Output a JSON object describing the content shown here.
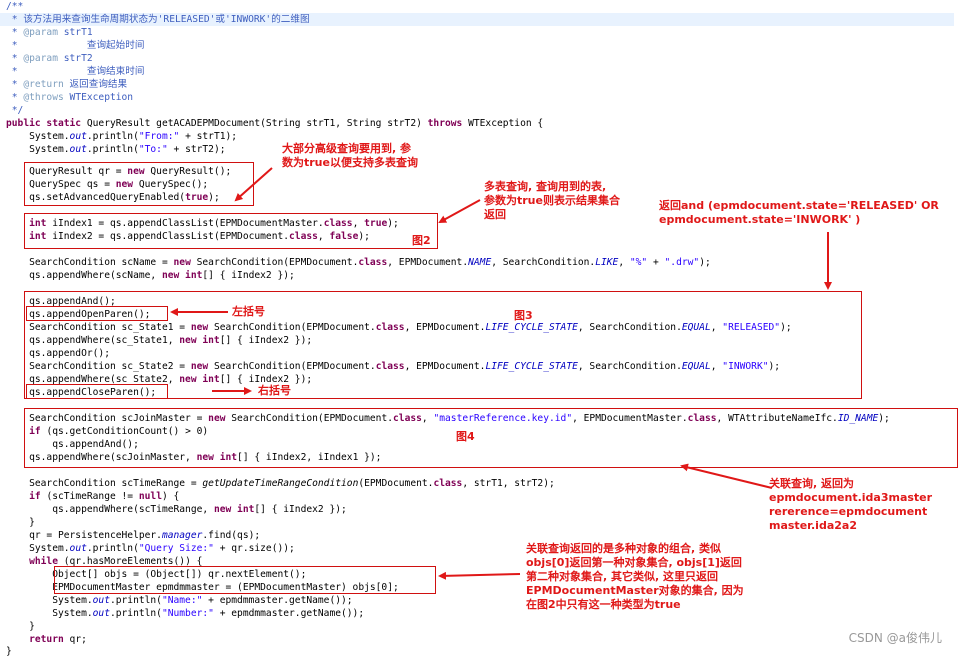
{
  "code": {
    "l1": "/**",
    "l2a": " * 该方法用来查询生命周期状态为'RELEASED'或'INWORK'的",
    "l2b": "二维图",
    "l3a": " * ",
    "l3b": "@param",
    "l3c": " strT1",
    "l4": " *            查询起始时间",
    "l5a": " * ",
    "l5b": "@param",
    "l5c": " strT2",
    "l6": " *            查询结束时间",
    "l7a": " * ",
    "l7b": "@return",
    "l7c": " 返回查询结果",
    "l8a": " * ",
    "l8b": "@throws",
    "l8c": " WTException",
    "l9": " */",
    "l10a": "public static",
    "l10b": " QueryResult getACADEPMDocument(String strT1, String strT2) ",
    "l10c": "throws",
    "l10d": " WTException {",
    "l11a": "    System.",
    "l11b": "out",
    "l11c": ".println(",
    "l11d": "\"From:\"",
    "l11e": " + strT1);",
    "l12a": "    System.",
    "l12b": "out",
    "l12c": ".println(",
    "l12d": "\"To:\"",
    "l12e": " + strT2);",
    "l13a": "    QueryResult qr = ",
    "l13b": "new",
    "l13c": " QueryResult();",
    "l14a": "    QuerySpec qs = ",
    "l14b": "new",
    "l14c": " QuerySpec();",
    "l15a": "    qs.setAdvancedQueryEnabled(",
    "l15b": "true",
    "l15c": ");",
    "l16a": "    ",
    "l16b": "int",
    "l16c": " iIndex1 = qs.appendClassList(EPMDocumentMaster.",
    "l16d": "class",
    "l16e": ", ",
    "l16f": "true",
    "l16g": ");",
    "l17a": "    ",
    "l17b": "int",
    "l17c": " iIndex2 = qs.appendClassList(EPMDocument.",
    "l17d": "class",
    "l17e": ", ",
    "l17f": "false",
    "l17g": ");",
    "l18a": "    SearchCondition scName = ",
    "l18b": "new",
    "l18c": " SearchCondition(EPMDocument.",
    "l18d": "class",
    "l18e": ", EPMDocument.",
    "l18f": "NAME",
    "l18g": ", SearchCondition.",
    "l18h": "LIKE",
    "l18i": ", ",
    "l18j": "\"%\"",
    "l18k": " + ",
    "l18l": "\".drw\"",
    "l18m": ");",
    "l19a": "    qs.appendWhere(scName, ",
    "l19b": "new int",
    "l19c": "[] { iIndex2 });",
    "l20": "    qs.appendAnd();",
    "l21": "    qs.appendOpenParen();",
    "l22a": "    SearchCondition sc_State1 = ",
    "l22b": "new",
    "l22c": " SearchCondition(EPMDocument.",
    "l22d": "class",
    "l22e": ", EPMDocument.",
    "l22f": "LIFE_CYCLE_STATE",
    "l22g": ", SearchCondition.",
    "l22h": "EQUAL",
    "l22i": ", ",
    "l22j": "\"RELEASED\"",
    "l22k": ");",
    "l23a": "    qs.appendWhere(sc_State1, ",
    "l23b": "new int",
    "l23c": "[] { iIndex2 });",
    "l24": "    qs.appendOr();",
    "l25a": "    SearchCondition sc_State2 = ",
    "l25b": "new",
    "l25c": " SearchCondition(EPMDocument.",
    "l25d": "class",
    "l25e": ", EPMDocument.",
    "l25f": "LIFE_CYCLE_STATE",
    "l25g": ", SearchCondition.",
    "l25h": "EQUAL",
    "l25i": ", ",
    "l25j": "\"INWORK\"",
    "l25k": ");",
    "l26a": "    qs.appendWhere(sc_State2, ",
    "l26b": "new int",
    "l26c": "[] { iIndex2 });",
    "l27": "    qs.appendCloseParen();",
    "l28a": "    SearchCondition scJoinMaster = ",
    "l28b": "new",
    "l28c": " SearchCondition(EPMDocument.",
    "l28d": "class",
    "l28e": ", ",
    "l28f": "\"masterReference.key.id\"",
    "l28g": ", EPMDocumentMaster.",
    "l28h": "class",
    "l28i": ", WTAttributeNameIfc.",
    "l28j": "ID_NAME",
    "l28k": ");",
    "l29a": "    ",
    "l29b": "if",
    "l29c": " (qs.getConditionCount() > 0)",
    "l30": "        qs.appendAnd();",
    "l31a": "    qs.appendWhere(scJoinMaster, ",
    "l31b": "new int",
    "l31c": "[] { iIndex2, iIndex1 });",
    "l32a": "    SearchCondition scTimeRange = ",
    "l32b": "getUpdateTimeRangeCondition",
    "l32c": "(EPMDocument.",
    "l32d": "class",
    "l32e": ", strT1, strT2);",
    "l33a": "    ",
    "l33b": "if",
    "l33c": " (scTimeRange != ",
    "l33d": "null",
    "l33e": ") {",
    "l34a": "        qs.appendWhere(scTimeRange, ",
    "l34b": "new int",
    "l34c": "[] { iIndex2 });",
    "l35": "    }",
    "l36a": "    qr = PersistenceHelper.",
    "l36b": "manager",
    "l36c": ".find(qs);",
    "l37a": "    System.",
    "l37b": "out",
    "l37c": ".println(",
    "l37d": "\"Query Size:\"",
    "l37e": " + qr.size());",
    "l38a": "    ",
    "l38b": "while",
    "l38c": " (qr.hasMoreElements()) {",
    "l39": "        Object[] objs = (Object[]) qr.nextElement();",
    "l40": "        EPMDocumentMaster epmdmmaster = (EPMDocumentMaster) objs[0];",
    "l41a": "        System.",
    "l41b": "out",
    "l41c": ".println(",
    "l41d": "\"Name:\"",
    "l41e": " + epmdmmaster.getName());",
    "l42a": "        System.",
    "l42b": "out",
    "l42c": ".println(",
    "l42d": "\"Number:\"",
    "l42e": " + epmdmmaster.getName());",
    "l43": "    }",
    "l44a": "    ",
    "l44b": "return",
    "l44c": " qr;",
    "l45": "}"
  },
  "annotations": {
    "a1_l1": "大部分高级查询要用到, 参",
    "a1_l2": "数为true以便支持多表查询",
    "a2_l1": "多表查询, 查询用到的表,",
    "a2_l2": "参数为true则表示结果集合",
    "a2_l3": "返回",
    "a3_l1": "返回and (epmdocument.state='RELEASED' OR",
    "a3_l2": "epmdocument.state='INWORK' )",
    "fig2": "图2",
    "left_paren": "左括号",
    "fig3": "图3",
    "right_paren": "右括号",
    "fig4": "图4",
    "a4_l1": "关联查询,   返回为",
    "a4_l2": "epmdocument.ida3master",
    "a4_l3": "rererence=epmdocument",
    "a4_l4": "master.ida2a2",
    "a5_l1": "关联查询返回的是多种对象的组合, 类似",
    "a5_l2": "objs[0]返回第一种对象集合, objs[1]返回",
    "a5_l3": "第二种对象集合, 其它类似, 这里只返回",
    "a5_l4": "EPMDocumentMaster对象的集合, 因为",
    "a5_l5": "在图2中只有这一种类型为true"
  },
  "watermark": "CSDN @a俊伟儿",
  "colors": {
    "keyword": "#7f0055",
    "comment": "#3f5fbf",
    "javadoc_tag": "#7f9fbf",
    "string": "#2a00ff",
    "field": "#0000c0",
    "annotation_red": "#e01818",
    "current_line": "#e8f2fe"
  }
}
